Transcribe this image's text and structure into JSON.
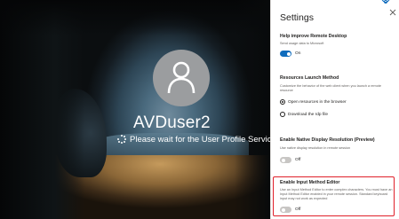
{
  "session": {
    "username": "AVDuser2",
    "status_message": "Please wait for the User Profile Service"
  },
  "settings": {
    "title": "Settings",
    "improve": {
      "title": "Help improve Remote Desktop",
      "description": "Send usage data to Microsoft",
      "toggle_state": "On"
    },
    "resources": {
      "title": "Resources Launch Method",
      "description": "Customize the behavior of the web client when you launch a remote resource",
      "options": [
        "Open resources in the browser",
        "Download the rdp file"
      ],
      "selected": "Open resources in the browser"
    },
    "display": {
      "title": "Enable Native Display Resolution (Preview)",
      "description": "Use native display resolution in remote session",
      "toggle_state": "Off"
    },
    "ime": {
      "title": "Enable Input Method Editor",
      "description": "Use an Input Method Editor to enter complex characters. You must have an Input Method Editor enabled in your remote session. Standard keyboard input may not work as expected",
      "toggle_state": "Off"
    }
  },
  "colors": {
    "toggle_on": "#0f6cbd",
    "toggle_off": "#c8c6c4",
    "highlight": "#e0202a",
    "avatar_bg": "#9b9d9f"
  },
  "icons": [
    "person-icon",
    "spinner-icon",
    "settings-corner-icon",
    "close-icon"
  ]
}
